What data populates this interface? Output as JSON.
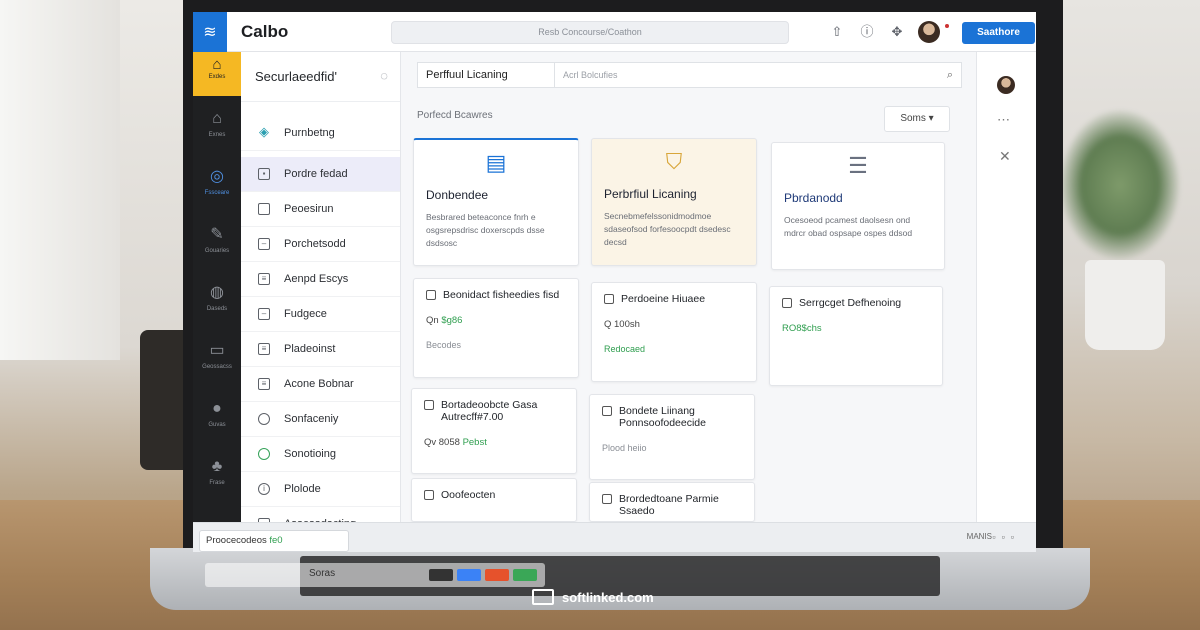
{
  "app": {
    "name": "Calbo",
    "logo_icon": "app-logo-icon",
    "global_search": "Resb Concourse/Coathon",
    "primary_button": "Saathore"
  },
  "rail": {
    "home": "Exdes",
    "items": [
      {
        "icon": "home-icon",
        "label": "Exnes"
      },
      {
        "icon": "compass-icon",
        "label": "Fssceare",
        "active": true
      },
      {
        "icon": "pen-icon",
        "label": "Gouaries"
      },
      {
        "icon": "globe-icon",
        "label": "Daseds"
      },
      {
        "icon": "box-icon",
        "label": "Geossacss"
      },
      {
        "icon": "circle-icon",
        "label": "Guvas"
      },
      {
        "icon": "puzzle-icon",
        "label": "Frase"
      }
    ]
  },
  "sidebar": {
    "title": "Securlaeedfid'",
    "items": [
      {
        "label": "Purnbetng"
      },
      {
        "label": "Pordre fedad",
        "selected": true
      },
      {
        "label": "Peoesirun"
      },
      {
        "label": "Porchetsodd"
      },
      {
        "label": "Aenpd Escys"
      },
      {
        "label": "Fudgece"
      },
      {
        "label": "Pladeoinst"
      },
      {
        "label": "Acone Bobnar"
      },
      {
        "label": "Sonfaceniy"
      },
      {
        "label": "Sonotioing"
      },
      {
        "label": "Plolode"
      },
      {
        "label": "Asoesodacting"
      }
    ]
  },
  "main": {
    "tab_label": "Perffuul Licaning",
    "filter_placeholder": "Acrl Bolcufies",
    "section_label": "Porfecd Bcawres",
    "sort_label": "Soms",
    "featured": [
      {
        "title": "Donbendee",
        "desc": "Besbrared beteaconce fnrh e osgsrepsdrisc doxerscpds dsse dsdsosc",
        "icon": "document-icon"
      },
      {
        "title": "Perbrfiul Licaning",
        "desc": "Secnebmefelssonidmodmoe sdaseofsod forfesoocpdt dsedesc decsd",
        "icon": "badge-icon"
      },
      {
        "title": "Pbrdanodd",
        "desc": "Ocesoeod pcamest daolsesn ond mdrcr obad ospsape ospes ddsod",
        "icon": "list-icon"
      }
    ],
    "cards": [
      {
        "title": "Beonidact fisheedies fisd",
        "meta_prefix": "Qn ",
        "meta_green": "$g86",
        "foot": "Becodes",
        "foot_green": false
      },
      {
        "title": "Perdoeine Hiuaee",
        "meta_prefix": "Q 100sh",
        "meta_green": "",
        "foot": "Redocaed",
        "foot_green": true
      },
      {
        "title": "Serrgcget Defhenoing",
        "meta_prefix": "",
        "meta_green": "RO8$chs",
        "foot": "",
        "foot_green": false
      },
      {
        "title": "Bortadeoobcte Gasa Autrecff#7.00",
        "meta_prefix": "Qv 8058 ",
        "meta_green": "Pebst",
        "foot": "",
        "foot_green": false
      },
      {
        "title": "Bondete Liinang Ponnsoofodeecide",
        "meta_prefix": "",
        "meta_green": "",
        "foot": "Plood heiio",
        "foot_green": false
      },
      {
        "title": "Ooofeocten",
        "meta_prefix": "",
        "meta_green": "",
        "foot": "",
        "foot_green": false
      },
      {
        "title": "Brordedtoane Parmie Ssaedo",
        "meta_prefix": "",
        "meta_green": "",
        "foot": "",
        "foot_green": false
      }
    ]
  },
  "status": {
    "pill_text": "Proocecodeos ",
    "pill_green": "fe0",
    "tray_label": "MANIS"
  },
  "dock": {
    "label": "Soras"
  },
  "watermark": "softlinked.com",
  "colors": {
    "accent": "#1b73d6",
    "home": "#f5b823",
    "green": "#2f9e4f",
    "rail": "#1f2022"
  }
}
